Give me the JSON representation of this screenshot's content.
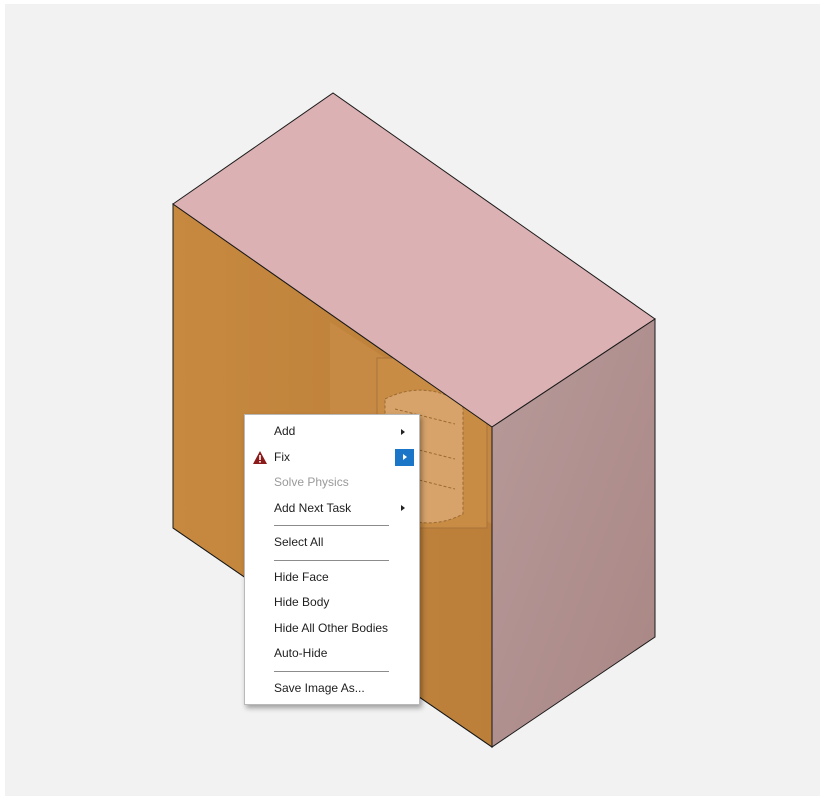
{
  "viewport": {
    "background": "#f2f2f2",
    "model": {
      "top_color": "#dcb1b3",
      "right_color": "#b79896",
      "left_color": "#c3863f",
      "inner_color": "#cc904c"
    }
  },
  "context_menu": {
    "items": [
      {
        "label": "Add",
        "submenu": true
      },
      {
        "label": "Fix",
        "submenu": true,
        "active": true,
        "icon": "warning-icon"
      },
      {
        "label": "Solve Physics",
        "disabled": true
      },
      {
        "label": "Add Next Task",
        "submenu": true
      },
      {
        "label": "Select All"
      },
      {
        "label": "Hide Face"
      },
      {
        "label": "Hide Body"
      },
      {
        "label": "Hide All Other Bodies"
      },
      {
        "label": "Auto-Hide"
      },
      {
        "label": "Save Image As..."
      }
    ],
    "accent_color": "#1b76c7",
    "warning_color": "#8b1a1a"
  }
}
